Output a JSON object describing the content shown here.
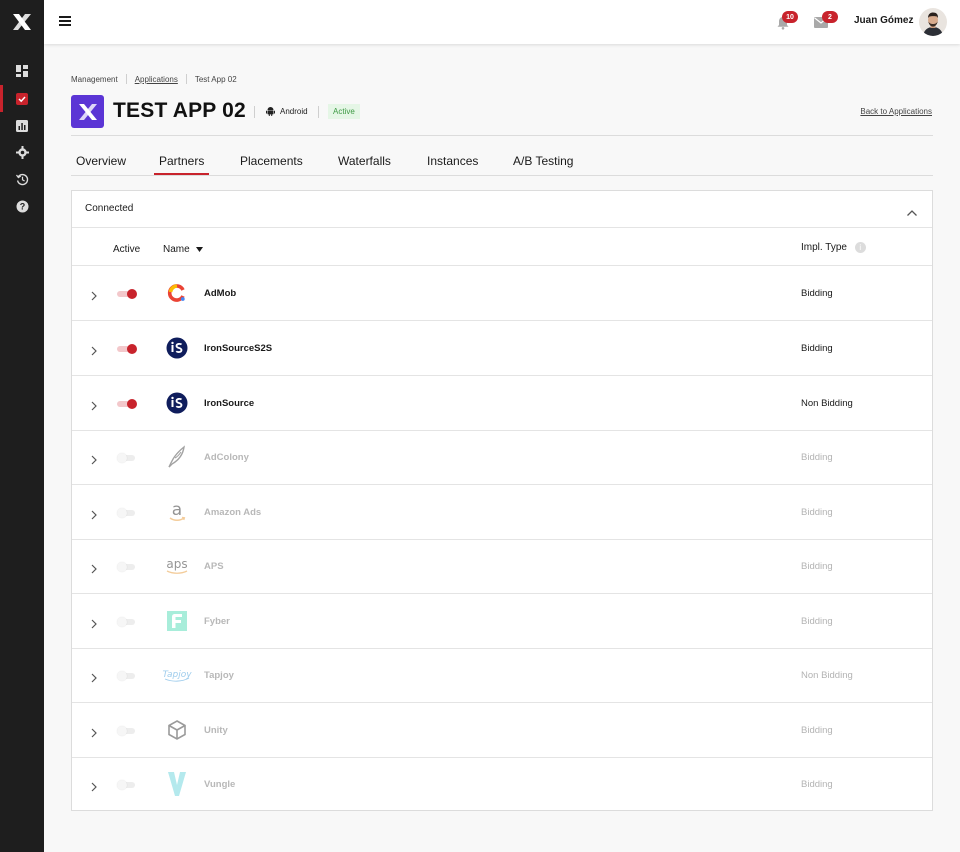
{
  "app": {
    "logo_icon": "x-brand-logo-icon"
  },
  "sidebar": {
    "items": [
      {
        "name": "dashboard-icon",
        "active": false
      },
      {
        "name": "applications-icon",
        "active": true
      },
      {
        "name": "analytics-icon",
        "active": false
      },
      {
        "name": "settings-gear-icon",
        "active": false
      },
      {
        "name": "history-icon",
        "active": false
      },
      {
        "name": "help-icon",
        "active": false
      }
    ]
  },
  "topbar": {
    "notifications_count": "10",
    "messages_count": "2",
    "user_name": "Juan Gómez"
  },
  "breadcrumb": {
    "items": [
      "Management",
      "Applications",
      "Test App 02"
    ]
  },
  "header": {
    "title": "TEST APP 02",
    "platform": "Android",
    "status": "Active",
    "back_link": "Back to Applications"
  },
  "tabs": [
    {
      "label": "Overview",
      "active": false
    },
    {
      "label": "Partners",
      "active": true
    },
    {
      "label": "Placements",
      "active": false
    },
    {
      "label": "Waterfalls",
      "active": false
    },
    {
      "label": "Instances",
      "active": false
    },
    {
      "label": "A/B Testing",
      "active": false
    }
  ],
  "panel": {
    "title": "Connected",
    "columns": {
      "active": "Active",
      "name": "Name",
      "impl_type": "Impl. Type"
    },
    "rows": [
      {
        "name": "AdMob",
        "impl_type": "Bidding",
        "active": true,
        "logo": "admob-logo-icon"
      },
      {
        "name": "IronSourceS2S",
        "impl_type": "Bidding",
        "active": true,
        "logo": "ironsource-logo-icon"
      },
      {
        "name": "IronSource",
        "impl_type": "Non Bidding",
        "active": true,
        "logo": "ironsource-logo-icon"
      },
      {
        "name": "AdColony",
        "impl_type": "Bidding",
        "active": false,
        "logo": "adcolony-logo-icon"
      },
      {
        "name": "Amazon Ads",
        "impl_type": "Bidding",
        "active": false,
        "logo": "amazon-logo-icon"
      },
      {
        "name": "APS",
        "impl_type": "Bidding",
        "active": false,
        "logo": "aps-logo-icon"
      },
      {
        "name": "Fyber",
        "impl_type": "Bidding",
        "active": false,
        "logo": "fyber-logo-icon"
      },
      {
        "name": "Tapjoy",
        "impl_type": "Non Bidding",
        "active": false,
        "logo": "tapjoy-logo-icon"
      },
      {
        "name": "Unity",
        "impl_type": "Bidding",
        "active": false,
        "logo": "unity-logo-icon"
      },
      {
        "name": "Vungle",
        "impl_type": "Bidding",
        "active": false,
        "logo": "vungle-logo-icon"
      }
    ]
  },
  "colors": {
    "accent": "#c8232c",
    "app_icon": "#5b35d5",
    "sidebar": "#1e1e1e",
    "status_green": "#3f9a45"
  }
}
